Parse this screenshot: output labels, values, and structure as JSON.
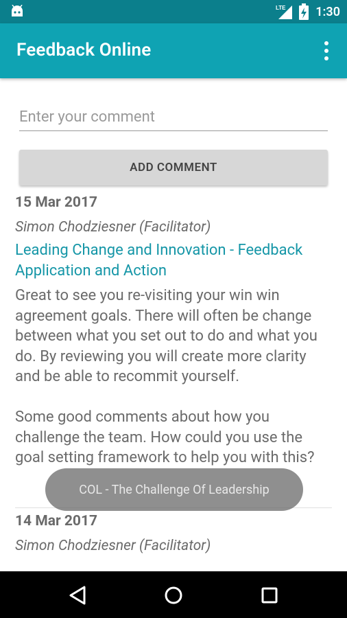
{
  "status_bar": {
    "time": "1:30",
    "network": "LTE",
    "icons": [
      "android-icon",
      "lte-signal-icon",
      "battery-charging-icon"
    ]
  },
  "app_bar": {
    "title": "Feedback Online",
    "menu_icon": "more-vert-icon"
  },
  "comment_form": {
    "placeholder": "Enter your comment",
    "value": "",
    "button_label": "ADD COMMENT"
  },
  "feedback": [
    {
      "date": "15 Mar 2017",
      "author": "Simon Chodziesner (Facilitator)",
      "course": "Leading Change and Innovation - Feedback Application and Action",
      "body": "Great to see you re-visiting your win win agreement goals. There will often be change between what you set out to do and what you do. By reviewing you will create more clarity and be able to recommit yourself.\n\nSome good comments about how you challenge the team. How could you use the goal setting framework to help you with this?"
    },
    {
      "date": "14 Mar 2017",
      "author": "Simon Chodziesner (Facilitator)"
    }
  ],
  "toast": {
    "text": "COL - The Challenge Of Leadership"
  },
  "nav_bar": {
    "icons": [
      "back-icon",
      "home-icon",
      "recents-icon"
    ]
  },
  "colors": {
    "status_bar": "#0b7f8c",
    "app_bar": "#0fa3b3",
    "accent_link": "#1596a7",
    "text": "#6a6a6a"
  }
}
